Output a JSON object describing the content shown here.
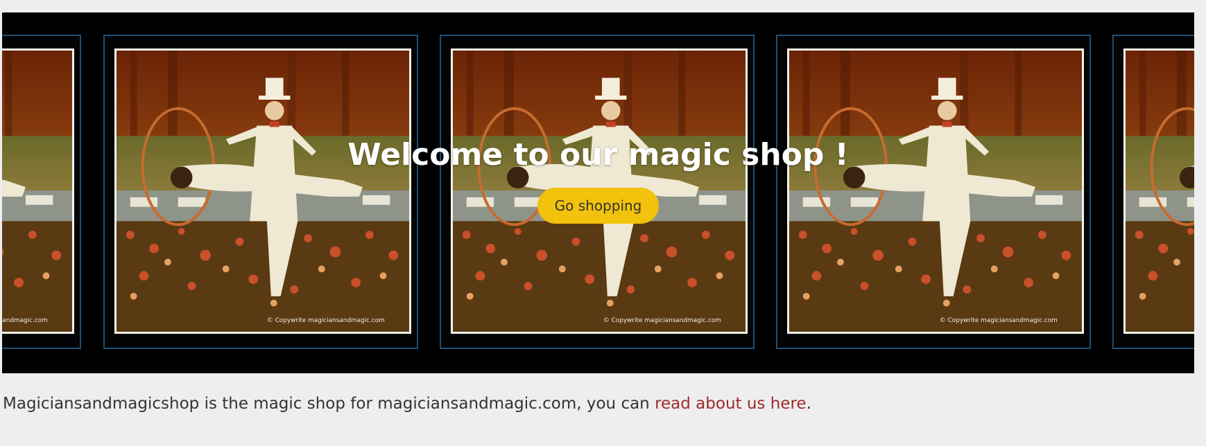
{
  "hero": {
    "title": "Welcome to our magic shop !",
    "button_label": "Go shopping",
    "photo_watermark": "© Copywrite magiciansandmagic.com",
    "frame_count": 4
  },
  "intro": {
    "text_before": "Magiciansandmagicshop is the magic shop for magiciansandmagic.com, you can ",
    "link_text": "read about us here",
    "text_after": "."
  },
  "colors": {
    "page_bg": "#eeeeee",
    "hero_bg": "#000000",
    "frame_border": "#1f4f73",
    "button_bg": "#f2c20c",
    "link": "#a12a2a"
  }
}
